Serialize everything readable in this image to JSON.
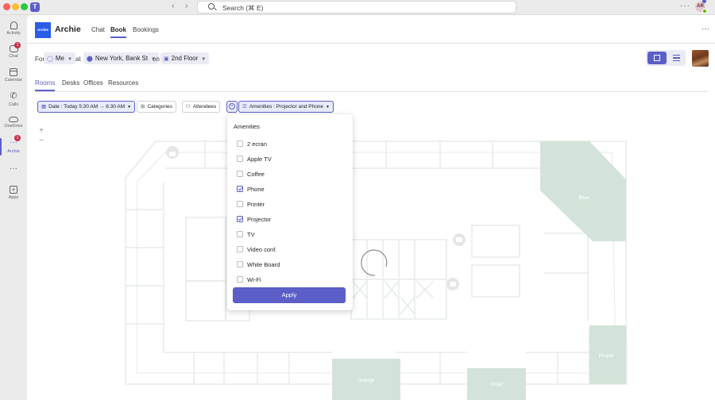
{
  "titlebar": {
    "search_placeholder": "Search (⌘ E)",
    "more_label": "···",
    "avatar_initials": "AR"
  },
  "rail": {
    "items": [
      {
        "label": "Activity",
        "badge": ""
      },
      {
        "label": "Chat",
        "badge": "1"
      },
      {
        "label": "Calendar",
        "badge": ""
      },
      {
        "label": "Calls",
        "badge": ""
      },
      {
        "label": "OneDrive",
        "badge": ""
      },
      {
        "label": "Archie",
        "badge": "1"
      },
      {
        "label": "Apps",
        "badge": ""
      }
    ],
    "more_label": "···"
  },
  "app": {
    "logo_text": "Archie",
    "name": "Archie",
    "tabs": [
      "Chat",
      "Book",
      "Bookings"
    ],
    "active_tab": "Book",
    "more_label": "···"
  },
  "location": {
    "for_label": "For",
    "person": "Me",
    "at_label": "at",
    "site": "New York, Bank St",
    "on_label": "on",
    "floor": "2nd Floor"
  },
  "subtabs": [
    "Rooms",
    "Desks",
    "Offices",
    "Resources"
  ],
  "active_subtab": "Rooms",
  "filters": {
    "date": "Date : Today 5:30 AM → 6:30 AM",
    "categories": "Categories",
    "attendees": "Attendees",
    "amenities": "Amenities : Projector and Phone",
    "clear_glyph": "×"
  },
  "map": {
    "zoom_in": "+",
    "zoom_out": "−",
    "rooms": [
      "Blue",
      "Purple",
      "Orange",
      "Violet"
    ],
    "room_color": "#d3e3d9"
  },
  "amenities_dropdown": {
    "title": "Amenities",
    "options": [
      {
        "label": "2 ecran",
        "checked": false
      },
      {
        "label": "Apple TV",
        "checked": false
      },
      {
        "label": "Coffee",
        "checked": false
      },
      {
        "label": "Phone",
        "checked": true
      },
      {
        "label": "Printer",
        "checked": false
      },
      {
        "label": "Projector",
        "checked": true
      },
      {
        "label": "TV",
        "checked": false
      },
      {
        "label": "Video conf.",
        "checked": false
      },
      {
        "label": "White Board",
        "checked": false
      },
      {
        "label": "Wi-Fi",
        "checked": false
      }
    ],
    "apply_label": "Apply"
  },
  "colors": {
    "accent": "#5b5fc7",
    "room_fill": "#d3e3d9",
    "badge": "#c4314b"
  }
}
